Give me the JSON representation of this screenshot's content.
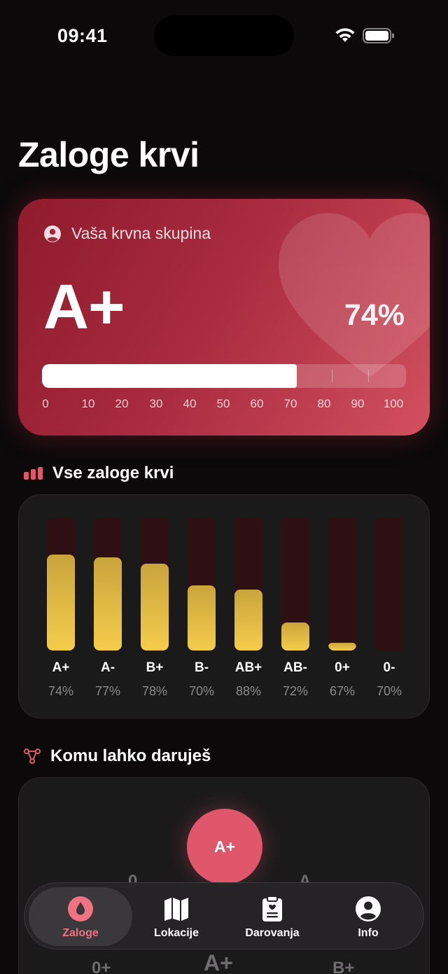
{
  "status": {
    "time": "09:41"
  },
  "title": "Zaloge krvi",
  "hero": {
    "label": "Vaša krvna skupina",
    "blood_type": "A+",
    "percent_text": "74%",
    "progress_fraction": 0.7,
    "scale": [
      "0",
      "10",
      "20",
      "30",
      "40",
      "50",
      "60",
      "70",
      "80",
      "90",
      "100"
    ]
  },
  "stock_section": {
    "title": "Vse zaloge krvi",
    "items": [
      {
        "type": "A+",
        "pct": "74%",
        "level": 0.72
      },
      {
        "type": "A-",
        "pct": "77%",
        "level": 0.7
      },
      {
        "type": "B+",
        "pct": "78%",
        "level": 0.65
      },
      {
        "type": "B-",
        "pct": "70%",
        "level": 0.49
      },
      {
        "type": "AB+",
        "pct": "88%",
        "level": 0.46
      },
      {
        "type": "AB-",
        "pct": "72%",
        "level": 0.21
      },
      {
        "type": "0+",
        "pct": "67%",
        "level": 0.06
      },
      {
        "type": "0-",
        "pct": "70%",
        "level": 0.0
      }
    ]
  },
  "donate_section": {
    "title": "Komu lahko daruješ",
    "donor": "A+",
    "recipients": [
      "0",
      "A",
      "0+",
      "A+",
      "B+"
    ]
  },
  "tabs": [
    {
      "label": "Zaloge",
      "icon": "blood-drop-icon",
      "active": true
    },
    {
      "label": "Lokacije",
      "icon": "map-icon",
      "active": false
    },
    {
      "label": "Darovanja",
      "icon": "clipboard-heart-icon",
      "active": false
    },
    {
      "label": "Info",
      "icon": "user-circle-icon",
      "active": false
    }
  ],
  "colors": {
    "accent": "#e0566a",
    "bar_fill": "#f5cc4b",
    "bar_track": "#2e0f14",
    "background": "#0b090a"
  }
}
